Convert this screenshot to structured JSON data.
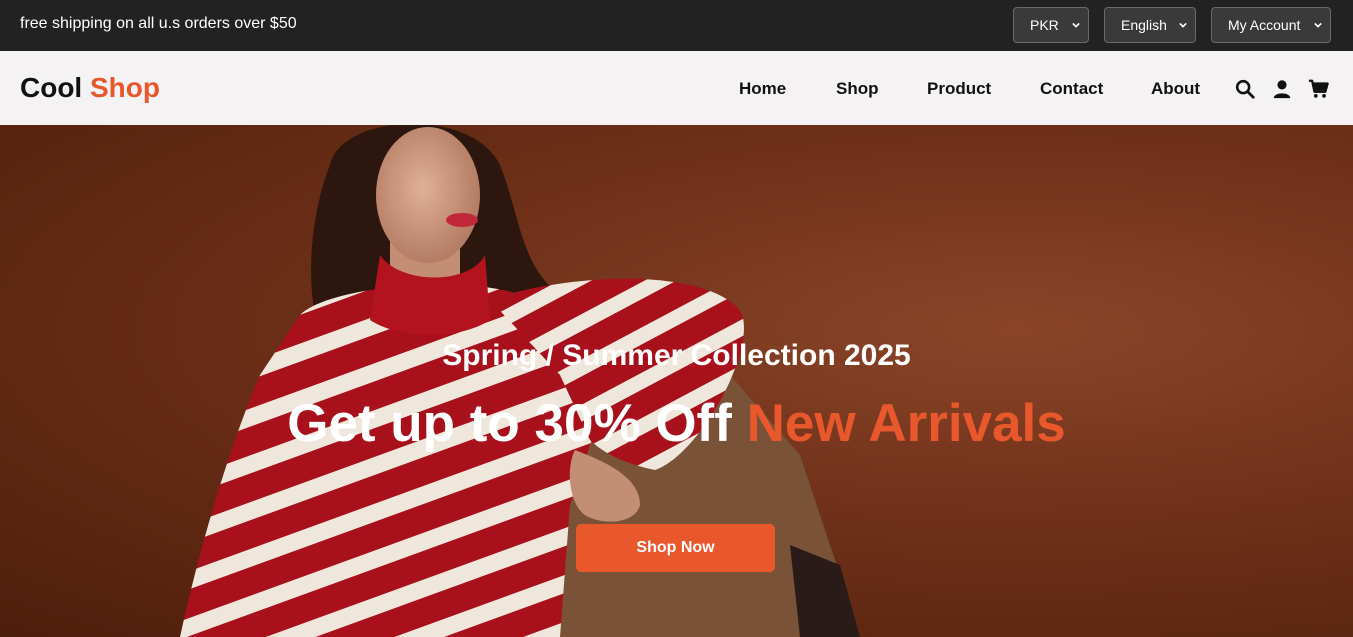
{
  "topbar": {
    "promo_text": "free shipping on all u.s orders over $50",
    "currency": {
      "selected": "PKR"
    },
    "language": {
      "selected": "English"
    },
    "account": {
      "selected": "My Account"
    }
  },
  "header": {
    "logo": {
      "part1": "Cool",
      "part2": "Shop"
    },
    "nav": [
      {
        "label": "Home"
      },
      {
        "label": "Shop"
      },
      {
        "label": "Product"
      },
      {
        "label": "Contact"
      },
      {
        "label": "About"
      }
    ],
    "icons": [
      "search-icon",
      "user-icon",
      "cart-icon"
    ]
  },
  "hero": {
    "subtitle": "Spring / Summer Collection 2025",
    "title_main": "Get up to 30% Off",
    "title_accent": "New Arrivals",
    "cta_label": "Shop Now"
  },
  "colors": {
    "accent": "#e8582c",
    "topbar_bg": "#222222",
    "navbar_bg": "#f4f2f3"
  }
}
